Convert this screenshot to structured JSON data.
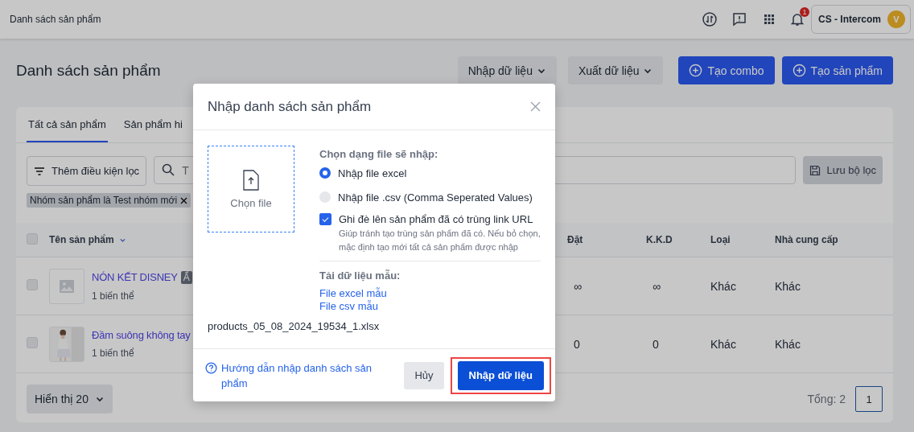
{
  "topbar": {
    "title": "Danh sách sản phẩm",
    "notification_count": "1",
    "account": {
      "name": "CS - Intercom",
      "avatar_initial": "V"
    }
  },
  "header": {
    "title": "Danh sách sản phẩm",
    "buttons": [
      {
        "label": "Nhập dữ liệu",
        "kind": "dropdown"
      },
      {
        "label": "Xuất dữ liệu",
        "kind": "dropdown"
      },
      {
        "label": "Tạo combo",
        "kind": "primary"
      },
      {
        "label": "Tạo sản phẩm",
        "kind": "primary"
      }
    ]
  },
  "tabs": [
    {
      "label": "Tất cả sản phẩm",
      "selected": true
    },
    {
      "label": "Sản phẩm hi",
      "selected": false
    }
  ],
  "filter": {
    "add_button": "Thêm điều kiện lọc",
    "search_placeholder": "T",
    "save_button": "Lưu bộ lọc",
    "tags": [
      "Nhóm sản phẩm là Test nhóm mới"
    ]
  },
  "table": {
    "select_all": {
      "checked": false
    },
    "columns": [
      "Tên sản phẩm",
      "Đặt",
      "K.K.D",
      "Loại",
      "Nhà cung cấp"
    ],
    "rows": [
      {
        "checked": false,
        "image": {
          "kind": "placeholder"
        },
        "name": "NÓN KẾT DISNEY",
        "badge": "Ẩ",
        "variants": "1 biến thể",
        "ordered": "∞",
        "kkd": "∞",
        "type": "Khác",
        "supplier": "Khác"
      },
      {
        "checked": false,
        "name": "Đầm suông không tay",
        "variants": "1 biến thể",
        "ordered": "0",
        "kkd": "0",
        "type": "Khác",
        "supplier": "Khác"
      }
    ]
  },
  "footer": {
    "page_size": "Hiển thị 20",
    "total": "Tổng: 2",
    "pages": [
      {
        "label": "1",
        "selected": true
      }
    ]
  },
  "modal": {
    "title": "Nhập danh sách sản phẩm",
    "dropzone": "Chọn file",
    "format_label": "Chọn dạng file sẽ nhập:",
    "formats": [
      {
        "label": "Nhập file excel",
        "selected": true
      },
      {
        "label": "Nhập file .csv (Comma Seperated Values)",
        "selected": false
      }
    ],
    "overwrite": {
      "label": "Ghi đè lên sản phẩm đã có trùng link URL",
      "checked": true,
      "hint": "Giúp tránh tạo trùng sản phẩm đã có. Nếu bỏ chọn, mặc định tạo mới tất cả sản phẩm được nhập"
    },
    "samples_label": "Tải dữ liệu mẫu:",
    "sample_links": [
      "File excel mẫu",
      "File csv mẫu"
    ],
    "file_name": "products_05_08_2024_19534_1.xlsx",
    "help_link": "Hướng dẫn nhập danh sách sản phẩm",
    "cancel": "Hủy",
    "submit": {
      "label": "Nhập dữ liệu",
      "highlighted": true
    }
  }
}
